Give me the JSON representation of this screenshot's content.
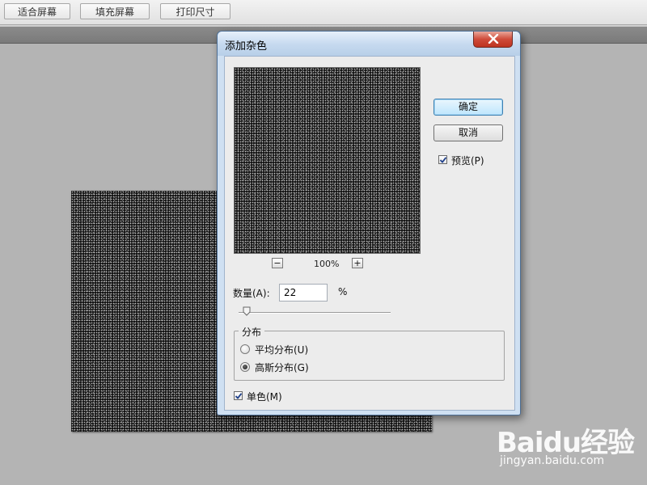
{
  "options_bar": {
    "buttons": [
      {
        "label": "适合屏幕"
      },
      {
        "label": "填充屏幕"
      },
      {
        "label": "打印尺寸"
      }
    ]
  },
  "dialog": {
    "title": "添加杂色",
    "ok_label": "确定",
    "cancel_label": "取消",
    "preview_label": "预览(P)",
    "preview_checked": true,
    "zoom": {
      "minus": "−",
      "plus": "+",
      "level": "100%"
    },
    "amount": {
      "label": "数量(A):",
      "value": "22",
      "unit": "%",
      "slider_fraction": 0.055
    },
    "distribution": {
      "legend": "分布",
      "options": [
        {
          "label": "平均分布(U)",
          "selected": false
        },
        {
          "label": "高斯分布(G)",
          "selected": true
        }
      ]
    },
    "monochromatic": {
      "label": "单色(M)",
      "checked": true
    }
  },
  "watermark": {
    "logo_text": "Baidu经验",
    "url": "jingyan.baidu.com"
  },
  "colors": {
    "workspace": "#b4b4b4",
    "canvas_noise_bg": "#141414",
    "close_button": "#cf4b3a",
    "default_button": "#bee6fd"
  }
}
